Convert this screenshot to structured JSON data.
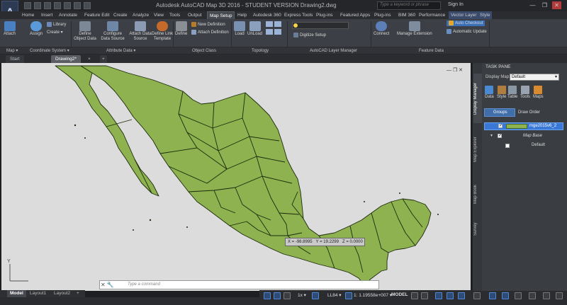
{
  "title_bar": {
    "app_logo": "A",
    "title": "Autodesk AutoCAD Map 3D 2016 - STUDENT VERSION  Drawing2.dwg",
    "search_placeholder": "Type a keyword or phrase",
    "sign_in": "Sign In"
  },
  "ribbon_tabs": [
    "Home",
    "Insert",
    "Annotate",
    "Feature Edit",
    "Create",
    "Analyze",
    "View",
    "Tools",
    "Output",
    "Map Setup",
    "Help",
    "Autodesk 360",
    "Express Tools",
    "Plug-ins",
    "Featured Apps",
    "Plug-ins",
    "BIM 360",
    "Performance",
    "Vector Layer",
    "Style"
  ],
  "active_tab": "Map Setup",
  "ribbon": {
    "attach": "Attach",
    "assign": "Assign",
    "library": "Library",
    "create": "Create",
    "define_object_data": "Define Object Data",
    "configure_data_source": "Configure Data Source",
    "attach_data_source": "Attach Data Source",
    "define_link_template": "Define Link Template",
    "define": "Define",
    "new_definition": "New Definition",
    "attach_definition": "Attach Definition",
    "load": "Load",
    "unload": "UnLoad",
    "digitize_setup": "Digitize Setup",
    "connect": "Connect",
    "manage_extension": "Manage Extension",
    "auto_checkout": "Auto Checkout",
    "automatic_update": "Automatic Update"
  },
  "panels": {
    "map": "Map",
    "coordinate_system": "Coordinate System",
    "attribute_data": "Attribute Data",
    "object_class": "Object Class",
    "topology": "Topology",
    "layer_manager": "AutoCAD Layer Manager",
    "feature_data": "Feature Data"
  },
  "doc_tabs": [
    "Start",
    "Drawing2*"
  ],
  "active_doc": "Drawing2*",
  "coordinates": {
    "x_label": "X = -98.8995",
    "y_label": "Y = 19.2299",
    "z_label": "Z = 0.0000"
  },
  "command_line": {
    "placeholder": "Type a command"
  },
  "ucs_label": "Y",
  "layout_tabs": [
    "Model",
    "Layout1",
    "Layout2"
  ],
  "status": {
    "scale": "1x",
    "crs": "LL84",
    "map_scale": "1: 1.19558e+007",
    "mode": "MODEL"
  },
  "task_pane": {
    "title": "TASK PANE",
    "display_map_label": "Display Map:",
    "display_map_value": "Default",
    "buttons": [
      "Data",
      "Style",
      "Table",
      "Tools",
      "Maps"
    ],
    "groups": "Groups",
    "draw_order": "Draw Order",
    "layer_name": "mge2015v6_2",
    "map_base": "Map Base",
    "default_item": "Default",
    "side_tabs": [
      "Display Manager",
      "Map Explorer",
      "Map Book",
      "Survey"
    ]
  },
  "colors": {
    "map_fill": "#8db24f",
    "map_stroke": "#1b2a0c",
    "canvas": "#dcdcdc",
    "selection": "#3a78d8"
  }
}
